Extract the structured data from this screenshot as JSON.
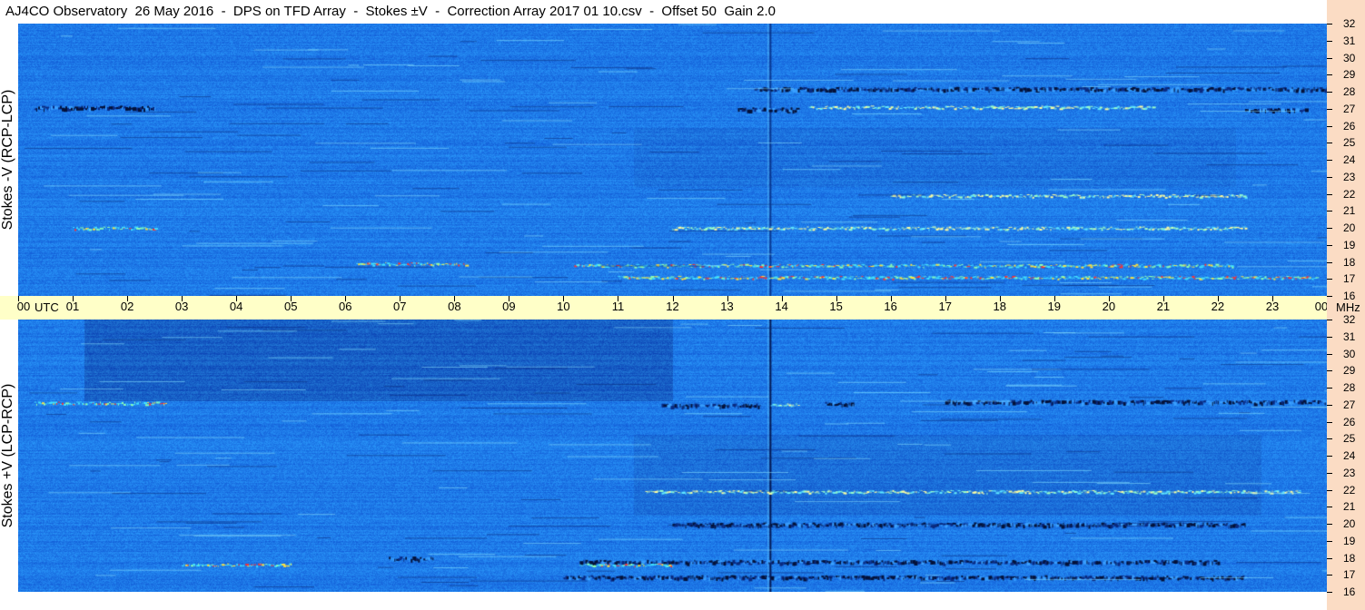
{
  "title": "AJ4CO Observatory  26 May 2016  -  DPS on TFD Array  -  Stokes ±V  -  Correction Array 2017 01 10.csv  -  Offset 50  Gain 2.0",
  "colors": {
    "background_blue": "#1e7ae8",
    "dark_blue": "#0a2c86",
    "time_axis_bg": "#ffffc8",
    "freq_axis_bg": "#fbdcc4"
  },
  "chart_data": {
    "type": "heatmap",
    "x_axis": {
      "unit_label": "UTC",
      "range_hours": [
        0,
        24
      ],
      "ticks": [
        "00",
        "01",
        "02",
        "03",
        "04",
        "05",
        "06",
        "07",
        "08",
        "09",
        "10",
        "11",
        "12",
        "13",
        "14",
        "15",
        "16",
        "17",
        "18",
        "19",
        "20",
        "21",
        "22",
        "23",
        "00"
      ]
    },
    "y_axis": {
      "unit_label": "MHz",
      "range_mhz": [
        16,
        32
      ],
      "ticks": [
        "32",
        "31",
        "30",
        "29",
        "28",
        "27",
        "26",
        "25",
        "24",
        "23",
        "22",
        "21",
        "20",
        "19",
        "18",
        "17",
        "16"
      ]
    },
    "panels": [
      {
        "ylabel": "Stokes -V (RCP-LCP)",
        "seed": 17,
        "dark_band": false,
        "features": [
          {
            "t0": 0.3,
            "t1": 2.5,
            "f": 27.1,
            "kind": "dark"
          },
          {
            "t0": 6.2,
            "t1": 8.2,
            "f": 17.9,
            "kind": "hot"
          },
          {
            "t0": 10.2,
            "t1": 22.3,
            "f": 17.8,
            "kind": "hot"
          },
          {
            "t0": 11.0,
            "t1": 23.8,
            "f": 17.1,
            "kind": "hot"
          },
          {
            "t0": 13.2,
            "t1": 14.3,
            "f": 27.0,
            "kind": "dark"
          },
          {
            "t0": 14.5,
            "t1": 20.8,
            "f": 27.1,
            "kind": "bright"
          },
          {
            "t0": 22.5,
            "t1": 23.6,
            "f": 27.0,
            "kind": "dark"
          },
          {
            "t0": 13.5,
            "t1": 24.0,
            "f": 28.2,
            "kind": "dark"
          },
          {
            "t0": 16.0,
            "t1": 22.5,
            "f": 21.9,
            "kind": "bright"
          },
          {
            "t0": 1.0,
            "t1": 2.5,
            "f": 20.0,
            "kind": "hot"
          },
          {
            "t0": 12.0,
            "t1": 22.5,
            "f": 20.0,
            "kind": "bright"
          }
        ]
      },
      {
        "ylabel": "Stokes +V (LCP-RCP)",
        "seed": 29,
        "dark_band": true,
        "features": [
          {
            "t0": 0.3,
            "t1": 2.7,
            "f": 27.1,
            "kind": "hot"
          },
          {
            "t0": 11.8,
            "t1": 13.6,
            "f": 27.0,
            "kind": "dark"
          },
          {
            "t0": 13.8,
            "t1": 14.3,
            "f": 27.0,
            "kind": "bright"
          },
          {
            "t0": 14.8,
            "t1": 15.3,
            "f": 27.1,
            "kind": "dark"
          },
          {
            "t0": 17.0,
            "t1": 24.0,
            "f": 27.2,
            "kind": "dark"
          },
          {
            "t0": 3.0,
            "t1": 5.0,
            "f": 17.6,
            "kind": "hot"
          },
          {
            "t0": 6.8,
            "t1": 7.6,
            "f": 18.0,
            "kind": "dark"
          },
          {
            "t0": 10.3,
            "t1": 22.0,
            "f": 17.8,
            "kind": "dark"
          },
          {
            "t0": 10.3,
            "t1": 12.0,
            "f": 17.6,
            "kind": "hot"
          },
          {
            "t0": 10.0,
            "t1": 22.5,
            "f": 16.9,
            "kind": "dark"
          },
          {
            "t0": 11.5,
            "t1": 23.5,
            "f": 21.9,
            "kind": "bright"
          },
          {
            "t0": 12.0,
            "t1": 22.5,
            "f": 20.0,
            "kind": "dark"
          }
        ]
      }
    ]
  }
}
